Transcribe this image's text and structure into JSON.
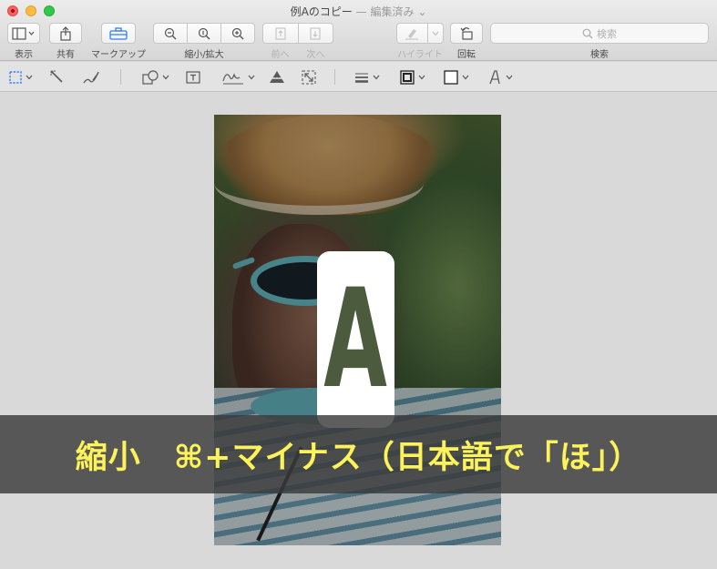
{
  "window": {
    "title": "例Aのコピー",
    "separator": "—",
    "status": "編集済み",
    "status_chevron": "chevron-down-icon"
  },
  "toolbar": {
    "view_label": "表示",
    "share_label": "共有",
    "markup_label": "マークアップ",
    "zoom_label": "縮小/拡大",
    "prev_label": "前へ",
    "next_label": "次へ",
    "highlight_label": "ハイライト",
    "rotate_label": "回転",
    "search_label": "検索",
    "search_placeholder": "検索"
  },
  "markup_tools": [
    "rectangular-selection-icon",
    "instant-alpha-icon",
    "sketch-icon",
    "shapes-icon",
    "text-icon",
    "sign-icon",
    "adjust-color-icon",
    "adjust-size-icon",
    "shape-style-icon",
    "border-color-icon",
    "fill-color-icon",
    "text-style-icon"
  ],
  "colors": {
    "caption_text": "#fcf25a",
    "caption_band": "#3a3a3a",
    "accent_blue": "#2f7ef6"
  },
  "content": {
    "card_letter": "A",
    "caption": "縮小　⌘+マイナス（日本語で「ほ」）"
  }
}
